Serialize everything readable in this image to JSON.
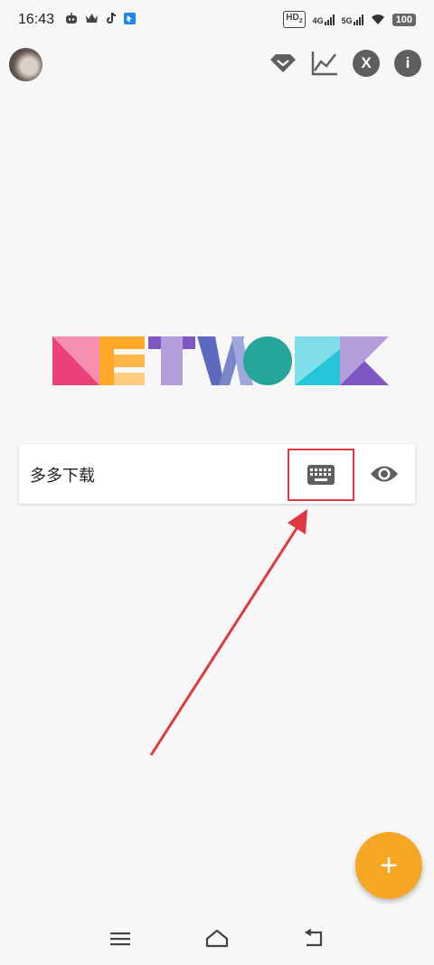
{
  "status_bar": {
    "time": "16:43",
    "hd_label": "HD",
    "hd_sub": "2",
    "net1": "4G",
    "net2": "5G",
    "battery": "100",
    "left_icons": [
      "robot-icon",
      "crown-icon",
      "tiktok-icon",
      "app-icon"
    ]
  },
  "toolbar": {
    "icons": [
      "vip-diamond-icon",
      "chart-icon",
      "x-circle-icon",
      "info-icon"
    ],
    "x_label": "X",
    "info_label": "i"
  },
  "logo": {
    "alt": "NETWORK",
    "colors": [
      "#e84d8a",
      "#f5a623",
      "#7e57c2",
      "#5c6bc0",
      "#26a69a",
      "#26c6da",
      "#9575cd"
    ]
  },
  "card": {
    "text": "多多下载",
    "keyboard_icon": "keyboard-icon",
    "eye_icon": "eye-icon"
  },
  "annotation": {
    "highlight_color": "#e0383f"
  },
  "fab": {
    "label": "+",
    "color": "#f5a623"
  },
  "nav": {
    "icons": [
      "menu-icon",
      "home-icon",
      "back-icon"
    ]
  }
}
